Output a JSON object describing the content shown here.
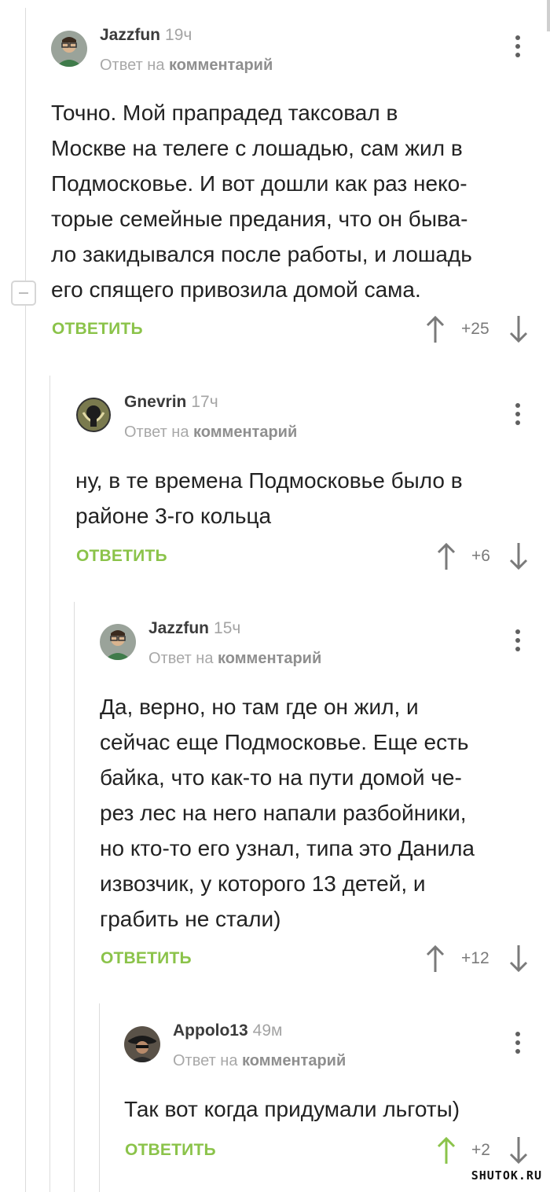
{
  "colors": {
    "accent_green": "#8bc34a",
    "text": "#222222",
    "meta": "#a8a8a8",
    "upvoted": "#8bc34a"
  },
  "comments": [
    {
      "author": "Jazzfun",
      "time": "19ч",
      "reply_prefix": "Ответ на",
      "reply_target": "комментарий",
      "lines": [
        "Точно. Мой прапрадед таксовал в",
        "Москве на телеге с лошадью, сам жил в",
        "Подмосковье. И вот дошли как раз неко-",
        "торые семейные предания, что он быва-",
        "ло закидывался после работы, и лошадь",
        "его спящего привозила домой сама."
      ],
      "reply_label": "ОТВЕТИТЬ",
      "score": "+25",
      "avatar_icon": "user-avatar-icon"
    },
    {
      "author": "Gnevrin",
      "time": "17ч",
      "reply_prefix": "Ответ на",
      "reply_target": "комментарий",
      "lines": [
        "ну, в те времена Подмосковье было в",
        "районе 3-го кольца"
      ],
      "reply_label": "ОТВЕТИТЬ",
      "score": "+6",
      "avatar_icon": "emblem-avatar-icon"
    },
    {
      "author": "Jazzfun",
      "time": "15ч",
      "reply_prefix": "Ответ на",
      "reply_target": "комментарий",
      "lines": [
        "Да, верно, но там где он жил, и",
        "сейчас еще Подмосковье. Еще есть",
        "байка, что как-то на пути домой че-",
        "рез лес на него напали разбойники,",
        "но кто-то его узнал, типа это Данила",
        "извозчик, у которого 13 детей, и",
        "грабить не стали)"
      ],
      "reply_label": "ОТВЕТИТЬ",
      "score": "+12",
      "avatar_icon": "user-avatar-icon"
    },
    {
      "author": "Appolo13",
      "time": "49м",
      "reply_prefix": "Ответ на",
      "reply_target": "комментарий",
      "lines": [
        "Так вот когда придумали льготы)"
      ],
      "reply_label": "ОТВЕТИТЬ",
      "score": "+2",
      "avatar_icon": "user-avatar-icon"
    }
  ],
  "watermark": "SHUTOK.RU"
}
